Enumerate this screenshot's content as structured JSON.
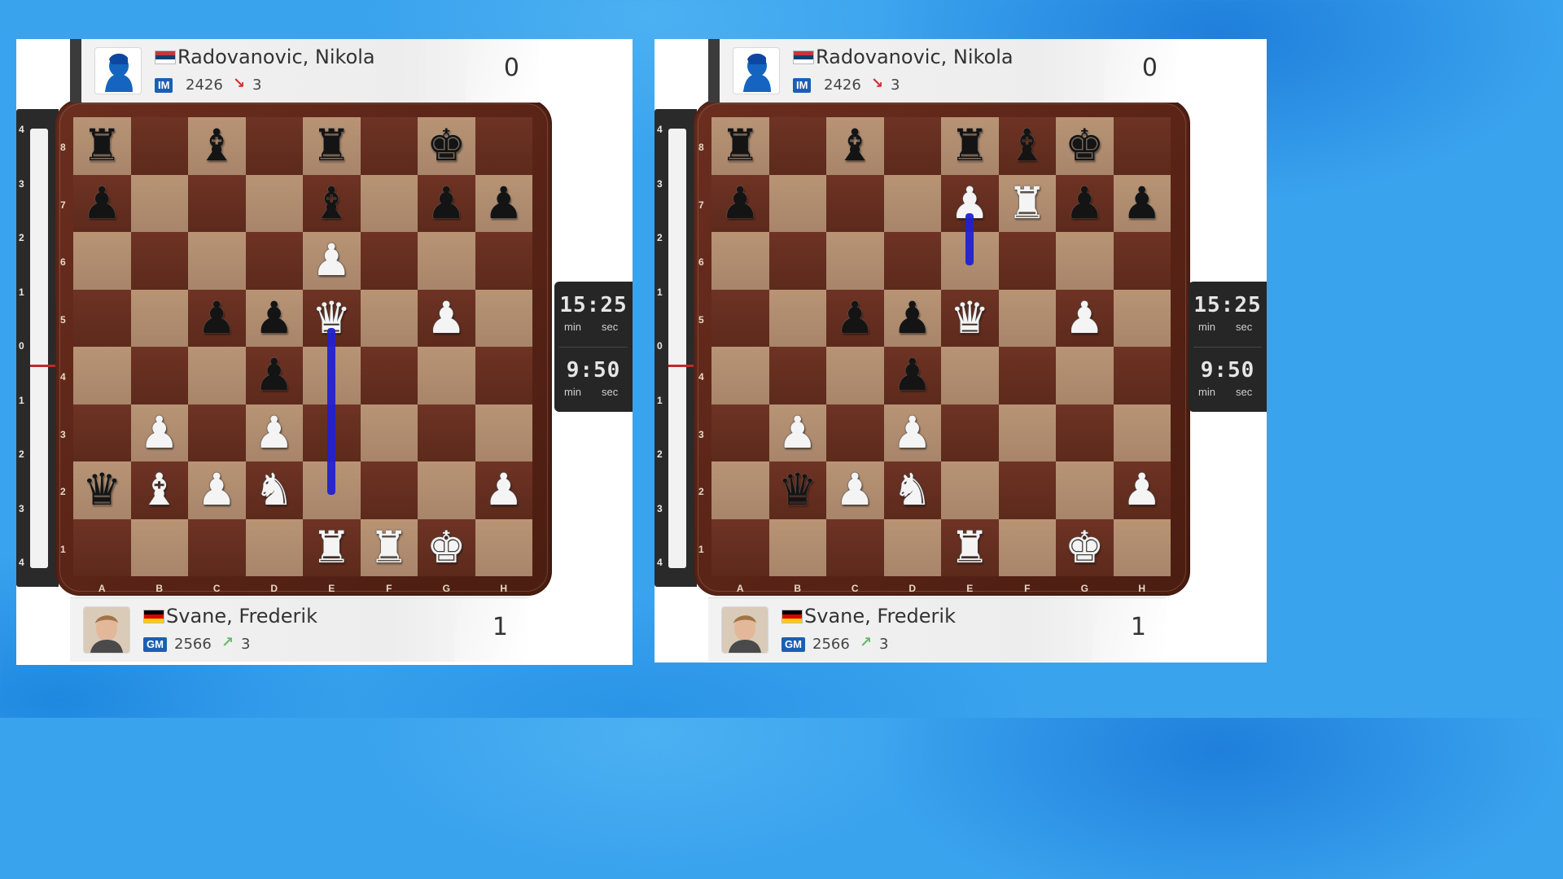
{
  "boards": [
    {
      "id": "left",
      "top_player": {
        "name": "Radovanovic, Nikola",
        "title": "IM",
        "rating": "2426",
        "trend_value": "3",
        "trend_direction": "down",
        "score": "0",
        "avatar_icon": "silhouette-avatar-icon",
        "flag_icon": "serbia-flag-icon"
      },
      "bottom_player": {
        "name": "Svane, Frederik",
        "title": "GM",
        "rating": "2566",
        "trend_value": "3",
        "trend_direction": "up",
        "score": "1",
        "avatar_icon": "player-photo-avatar",
        "flag_icon": "germany-flag-icon"
      },
      "clock": {
        "top_time": "15:25",
        "bottom_time": "9:50",
        "unit_min": "min",
        "unit_sec": "sec"
      },
      "eval_bar": {
        "labels": [
          "4",
          "3",
          "2",
          "1",
          "0",
          "1",
          "2",
          "3",
          "4"
        ],
        "value": 0
      },
      "files": [
        "A",
        "B",
        "C",
        "D",
        "E",
        "F",
        "G",
        "H"
      ],
      "ranks": [
        "8",
        "7",
        "6",
        "5",
        "4",
        "3",
        "2",
        "1"
      ],
      "position": [
        [
          "bR",
          "",
          "bB",
          "",
          "bR",
          "",
          "bK",
          ""
        ],
        [
          "bP",
          "",
          "",
          "",
          "bB",
          "",
          "bP",
          "bP"
        ],
        [
          "",
          "",
          "",
          "",
          "wP",
          "",
          "",
          ""
        ],
        [
          "",
          "",
          "bP",
          "bP",
          "wQ",
          "",
          "wP",
          ""
        ],
        [
          "",
          "",
          "",
          "bP",
          "",
          "",
          "",
          ""
        ],
        [
          "",
          "wP",
          "",
          "wP",
          "",
          "",
          "",
          ""
        ],
        [
          "bQ",
          "wB",
          "wP",
          "wN",
          "",
          "",
          "",
          "wP"
        ],
        [
          "",
          "",
          "",
          "",
          "wR",
          "wR",
          "wK",
          ""
        ]
      ],
      "arrow": {
        "from": "e2",
        "to": "e5"
      }
    },
    {
      "id": "right",
      "top_player": {
        "name": "Radovanovic, Nikola",
        "title": "IM",
        "rating": "2426",
        "trend_value": "3",
        "trend_direction": "down",
        "score": "0",
        "avatar_icon": "silhouette-avatar-icon",
        "flag_icon": "serbia-flag-icon"
      },
      "bottom_player": {
        "name": "Svane, Frederik",
        "title": "GM",
        "rating": "2566",
        "trend_value": "3",
        "trend_direction": "up",
        "score": "1",
        "avatar_icon": "player-photo-avatar",
        "flag_icon": "germany-flag-icon"
      },
      "clock": {
        "top_time": "15:25",
        "bottom_time": "9:50",
        "unit_min": "min",
        "unit_sec": "sec"
      },
      "eval_bar": {
        "labels": [
          "4",
          "3",
          "2",
          "1",
          "0",
          "1",
          "2",
          "3",
          "4"
        ],
        "value": 0
      },
      "files": [
        "A",
        "B",
        "C",
        "D",
        "E",
        "F",
        "G",
        "H"
      ],
      "ranks": [
        "8",
        "7",
        "6",
        "5",
        "4",
        "3",
        "2",
        "1"
      ],
      "position": [
        [
          "bR",
          "",
          "bB",
          "",
          "bR",
          "bB",
          "bK",
          ""
        ],
        [
          "bP",
          "",
          "",
          "",
          "wP",
          "wR",
          "bP",
          "bP"
        ],
        [
          "",
          "",
          "",
          "",
          "",
          "",
          "",
          ""
        ],
        [
          "",
          "",
          "bP",
          "bP",
          "wQ",
          "",
          "wP",
          ""
        ],
        [
          "",
          "",
          "",
          "bP",
          "",
          "",
          "",
          ""
        ],
        [
          "",
          "wP",
          "",
          "wP",
          "",
          "",
          "",
          ""
        ],
        [
          "",
          "bQ",
          "wP",
          "wN",
          "",
          "",
          "",
          "wP"
        ],
        [
          "",
          "",
          "",
          "",
          "wR",
          "",
          "wK",
          ""
        ]
      ],
      "arrow": {
        "from": "e6",
        "to": "e7"
      }
    }
  ],
  "colors": {
    "accent_blue": "#1b5fb4",
    "arrow": "#2222cc",
    "trend_down": "#d32f2f",
    "trend_up": "#66bb6a",
    "eval_zero_line": "#c62828"
  }
}
